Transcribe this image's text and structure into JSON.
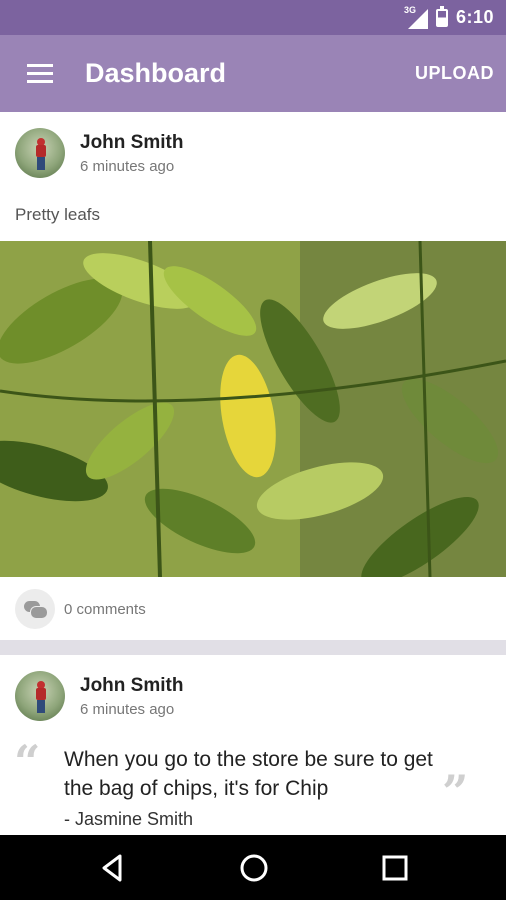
{
  "status_bar": {
    "network": "3G",
    "time": "6:10"
  },
  "app_bar": {
    "title": "Dashboard",
    "action": "UPLOAD",
    "background": "#9a84b6"
  },
  "posts": [
    {
      "author": "John Smith",
      "time": "6 minutes ago",
      "text": "Pretty leafs",
      "comments": "0 comments"
    },
    {
      "author": "John Smith",
      "time": "6 minutes ago",
      "quote": "When you go to the store be sure to get the bag of chips, it's for Chip",
      "quote_author": "- Jasmine Smith"
    }
  ],
  "icons": [
    "menu-icon",
    "comment-icon",
    "back-icon",
    "home-icon",
    "recents-icon"
  ]
}
